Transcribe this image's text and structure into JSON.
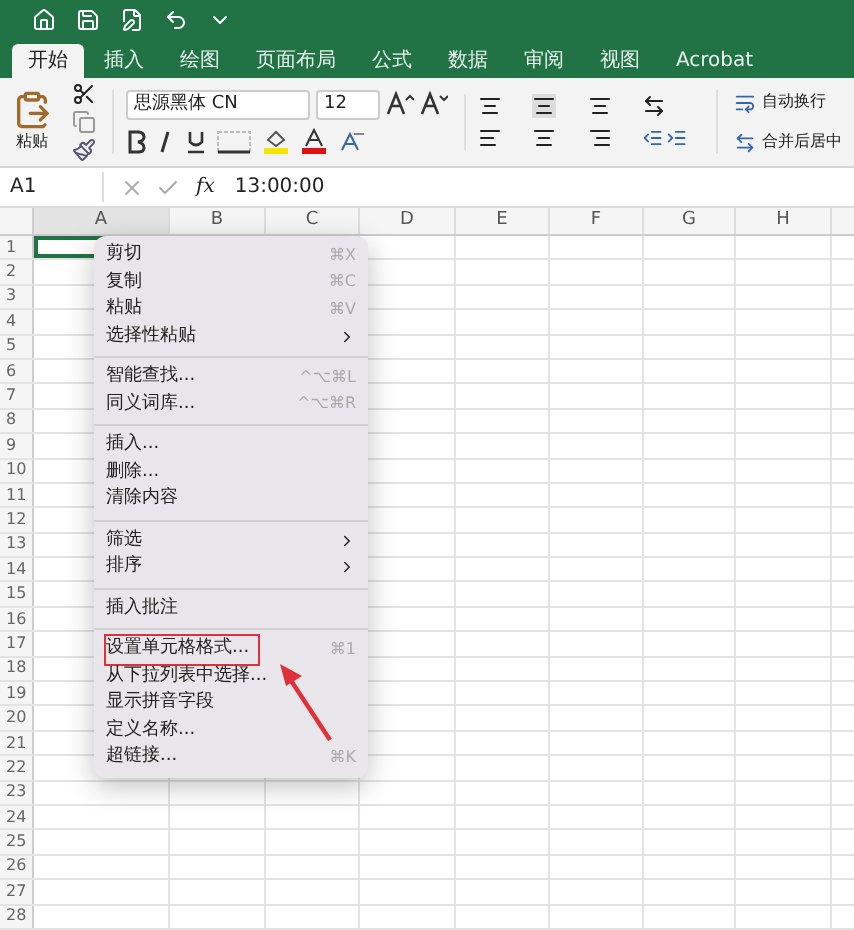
{
  "tabs": [
    {
      "label": "开始",
      "selected": true
    },
    {
      "label": "插入",
      "selected": false
    },
    {
      "label": "绘图",
      "selected": false
    },
    {
      "label": "页面布局",
      "selected": false
    },
    {
      "label": "公式",
      "selected": false
    },
    {
      "label": "数据",
      "selected": false
    },
    {
      "label": "审阅",
      "selected": false
    },
    {
      "label": "视图",
      "selected": false
    },
    {
      "label": "Acrobat",
      "selected": false
    }
  ],
  "ribbon": {
    "paste_label": "粘贴",
    "font_name": "思源黑体 CN",
    "font_size": "12",
    "wrap_text": "自动换行",
    "merge_center": "合并后居中"
  },
  "formula_bar": {
    "name_box": "A1",
    "function_label": "fx",
    "formula": "13:00:00"
  },
  "columns": [
    "A",
    "B",
    "C",
    "D",
    "E",
    "F",
    "G",
    "H"
  ],
  "rows": [
    "1",
    "2",
    "3",
    "4",
    "5",
    "6",
    "7",
    "8",
    "9",
    "10",
    "11",
    "12",
    "13",
    "14",
    "15",
    "16",
    "17",
    "18",
    "19",
    "20",
    "21",
    "22",
    "23",
    "24",
    "25",
    "26",
    "27",
    "28"
  ],
  "context_menu": {
    "groups": [
      [
        {
          "label": "剪切",
          "shortcut": "⌘X",
          "has_submenu": false,
          "highlighted": false
        },
        {
          "label": "复制",
          "shortcut": "⌘C",
          "has_submenu": false,
          "highlighted": false
        },
        {
          "label": "粘贴",
          "shortcut": "⌘V",
          "has_submenu": false,
          "highlighted": false
        },
        {
          "label": "选择性粘贴",
          "has_submenu": true,
          "highlighted": false
        }
      ],
      [
        {
          "label": "智能查找...",
          "shortcut": "^⌥⌘L",
          "has_submenu": false,
          "highlighted": false
        },
        {
          "label": "同义词库...",
          "shortcut": "^⌥⌘R",
          "has_submenu": false,
          "highlighted": false
        }
      ],
      [
        {
          "label": "插入...",
          "has_submenu": false,
          "highlighted": false
        },
        {
          "label": "删除...",
          "has_submenu": false,
          "highlighted": false
        },
        {
          "label": "清除内容",
          "has_submenu": false,
          "highlighted": false
        }
      ],
      [
        {
          "label": "筛选",
          "has_submenu": true,
          "highlighted": false
        },
        {
          "label": "排序",
          "has_submenu": true,
          "highlighted": false
        }
      ],
      [
        {
          "label": "插入批注",
          "has_submenu": false,
          "highlighted": false
        }
      ],
      [
        {
          "label": "设置单元格格式...",
          "shortcut": "⌘1",
          "has_submenu": false,
          "highlighted": true
        },
        {
          "label": "从下拉列表中选择...",
          "has_submenu": false,
          "highlighted": false
        },
        {
          "label": "显示拼音字段",
          "has_submenu": false,
          "highlighted": false
        },
        {
          "label": "定义名称...",
          "has_submenu": false,
          "highlighted": false
        },
        {
          "label": "超链接...",
          "shortcut": "⌘K",
          "has_submenu": false,
          "highlighted": false
        }
      ]
    ]
  }
}
